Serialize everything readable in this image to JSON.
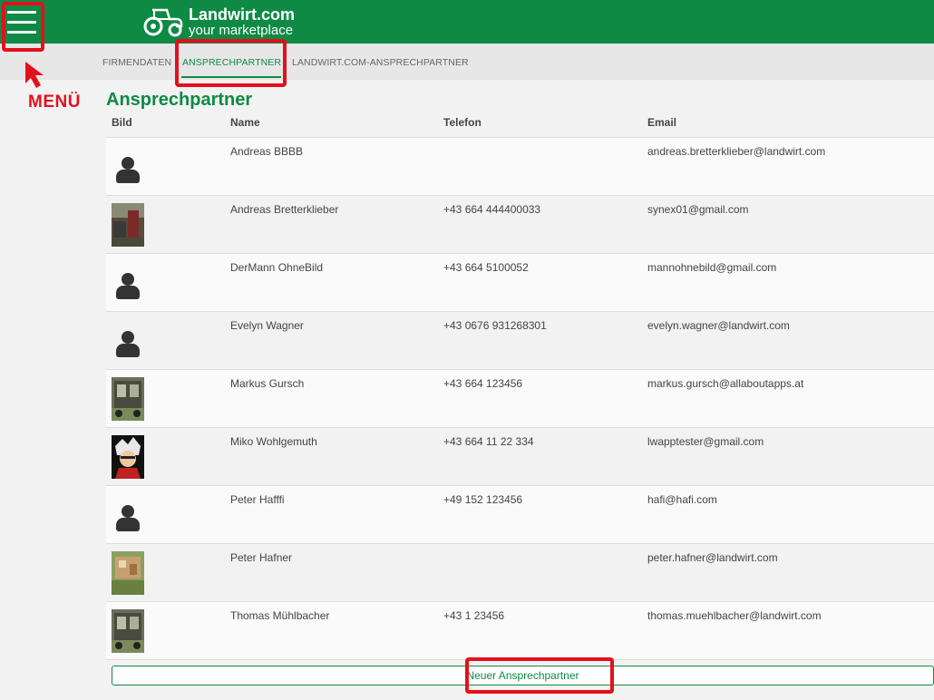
{
  "header": {
    "brand_name": "Landwirt.com",
    "brand_tagline": "your marketplace",
    "accent_color": "#0e8a45"
  },
  "annotations": {
    "menu_label": "MENÜ",
    "color": "#e3101e"
  },
  "tabs": [
    {
      "label": "FIRMENDATEN",
      "active": false
    },
    {
      "label": "ANSPRECHPARTNER",
      "active": true
    },
    {
      "label": "LANDWIRT.COM-ANSPRECHPARTNER",
      "active": false
    }
  ],
  "page": {
    "title": "Ansprechpartner"
  },
  "table": {
    "columns": [
      "Bild",
      "Name",
      "Telefon",
      "Email"
    ],
    "rows": [
      {
        "avatar": "generic-person-icon",
        "name": "Andreas BBBB",
        "phone": "",
        "email": "andreas.bretterklieber@landwirt.com"
      },
      {
        "avatar": "photo",
        "name": "Andreas Bretterklieber",
        "phone": "+43 664 444400033",
        "email": "synex01@gmail.com"
      },
      {
        "avatar": "generic-person-icon",
        "name": "DerMann OhneBild",
        "phone": "+43 664 5100052",
        "email": "mannohnebild@gmail.com"
      },
      {
        "avatar": "generic-person-icon",
        "name": "Evelyn Wagner",
        "phone": "+43 0676 931268301",
        "email": "evelyn.wagner@landwirt.com"
      },
      {
        "avatar": "photo",
        "name": "Markus Gursch",
        "phone": "+43 664 123456",
        "email": "markus.gursch@allaboutapps.at"
      },
      {
        "avatar": "photo",
        "name": "Miko Wohlgemuth",
        "phone": "+43 664 11 22 334",
        "email": "lwapptester@gmail.com"
      },
      {
        "avatar": "generic-person-icon",
        "name": "Peter Hafffi",
        "phone": "+49 152 123456",
        "email": "hafi@hafi.com"
      },
      {
        "avatar": "photo",
        "name": "Peter Hafner",
        "phone": "",
        "email": "peter.hafner@landwirt.com"
      },
      {
        "avatar": "photo",
        "name": "Thomas Mühlbacher",
        "phone": "+43 1 23456",
        "email": "thomas.muehlbacher@landwirt.com"
      }
    ]
  },
  "actions": {
    "new_contact_label": "Neuer Ansprechpartner"
  }
}
